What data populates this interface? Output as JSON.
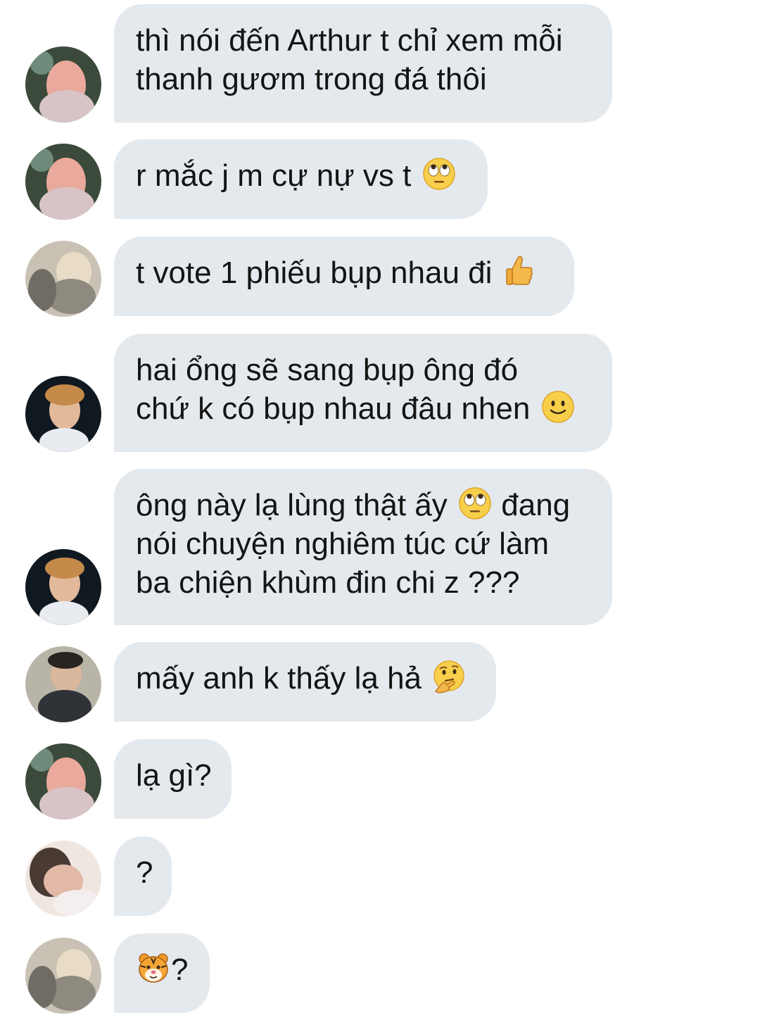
{
  "messages": [
    {
      "avatar": "avatar-pink-shirt",
      "lines": [
        "thì nói đến Arthur t chỉ xem mỗi",
        "thanh gươm trong đá thôi"
      ]
    },
    {
      "avatar": "avatar-pink-shirt",
      "text": "r mắc j m cự nự vs t",
      "emoji": "face-with-rolling-eyes"
    },
    {
      "avatar": "avatar-blonde-car",
      "text": "t vote 1 phiếu bụp nhau đi",
      "emoji": "thumbs-up"
    },
    {
      "avatar": "avatar-glasses",
      "lines": [
        "hai ổng sẽ sang bụp ông đó"
      ],
      "line2": "chứ k có bụp nhau đâu nhen",
      "emoji": "slightly-smiling-face"
    },
    {
      "avatar": "avatar-glasses",
      "line1": "ông này lạ lùng thật ấy",
      "emoji": "face-with-rolling-eyes",
      "line1b": "đang",
      "lines": [
        "nói chuyện nghiêm túc cứ làm",
        "ba chiện khùm đin chi z ???"
      ]
    },
    {
      "avatar": "avatar-dark-hair",
      "text": "mấy anh k thấy lạ hả",
      "emoji": "thinking-face"
    },
    {
      "avatar": "avatar-pink-shirt",
      "text": "lạ gì?"
    },
    {
      "avatar": "avatar-sleeping",
      "text": "?"
    },
    {
      "avatar": "avatar-blonde-car",
      "text": "?",
      "emoji": "tiger-face"
    }
  ],
  "colors": {
    "bubble": "#e4e9ee",
    "text": "#141414",
    "background": "#ffffff"
  }
}
